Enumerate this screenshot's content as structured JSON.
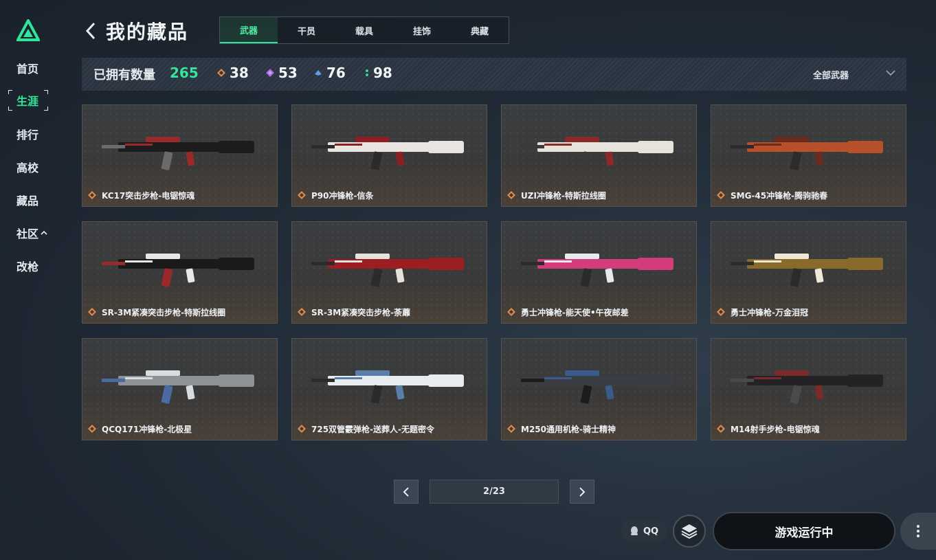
{
  "sidebar": {
    "items": [
      {
        "label": "首页"
      },
      {
        "label": "生涯",
        "active": true
      },
      {
        "label": "排行"
      },
      {
        "label": "高校"
      },
      {
        "label": "藏品"
      },
      {
        "label": "社区"
      },
      {
        "label": "改枪"
      }
    ],
    "accent": "#2fe59a"
  },
  "header": {
    "title": "我的藏品",
    "tabs": [
      {
        "label": "武器",
        "active": true
      },
      {
        "label": "干员"
      },
      {
        "label": "载具"
      },
      {
        "label": "挂饰"
      },
      {
        "label": "典藏"
      }
    ]
  },
  "stats": {
    "label": "已拥有数量",
    "total": "265",
    "rarities": [
      {
        "icon": "orange-diamond-icon",
        "color": "#e08a4a",
        "count": "38"
      },
      {
        "icon": "purple-diamond-icon",
        "color": "#a86be6",
        "count": "53"
      },
      {
        "icon": "blue-diamond-icon",
        "color": "#5a9bea",
        "count": "76"
      },
      {
        "icon": "green-dots-icon",
        "color": "#35d69a",
        "count": "98"
      }
    ],
    "filter": "全部武器"
  },
  "items": [
    {
      "name": "KC17突击步枪-电锯惊魂",
      "gun": "ar-dark"
    },
    {
      "name": "P90冲锋枪-信条",
      "gun": "p90"
    },
    {
      "name": "UZI冲锋枪-特斯拉线圈",
      "gun": "smg-white"
    },
    {
      "name": "SMG-45冲锋枪-腾驹驰春",
      "gun": "smg-orange"
    },
    {
      "name": "SR-3M紧凑突击步枪-特斯拉线圈",
      "gun": "ar-white"
    },
    {
      "name": "SR-3M紧凑突击步枪-荼蘼",
      "gun": "ar-red"
    },
    {
      "name": "勇士冲锋枪-能天使•午夜邮差",
      "gun": "smg-pink"
    },
    {
      "name": "勇士冲锋枪-万金泪冠",
      "gun": "smg-gold"
    },
    {
      "name": "QCQ171冲锋枪-北极星",
      "gun": "smg-silver"
    },
    {
      "name": "725双管霰弹枪-送葬人-无题密令",
      "gun": "shotgun"
    },
    {
      "name": "M250通用机枪-骑士精神",
      "gun": "lmg"
    },
    {
      "name": "M14射手步枪-电锯惊魂",
      "gun": "dmr-dark"
    }
  ],
  "pagination": {
    "label": "2/23"
  },
  "bottom": {
    "qq_label": "QQ",
    "game_status": "游戏运行中"
  }
}
